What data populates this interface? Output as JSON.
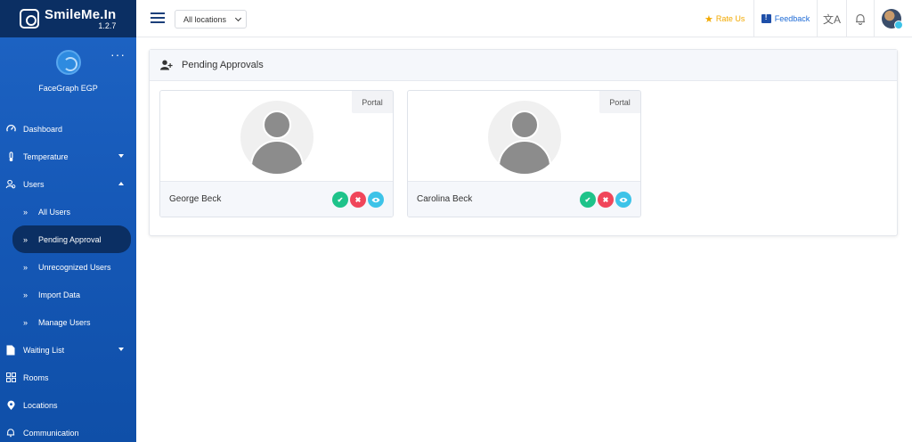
{
  "brand": {
    "name": "SmileMe.In",
    "version": "1.2.7"
  },
  "profile": {
    "name": "FaceGraph EGP",
    "more": "···"
  },
  "nav": {
    "dashboard": "Dashboard",
    "temperature": "Temperature",
    "users": "Users",
    "all_users": "All Users",
    "pending_approval": "Pending Approval",
    "unrecognized_users": "Unrecognized Users",
    "import_data": "Import Data",
    "manage_users": "Manage Users",
    "waiting_list": "Waiting List",
    "rooms": "Rooms",
    "locations": "Locations",
    "communication": "Communication"
  },
  "topbar": {
    "location_select": "All locations",
    "rate_us": "Rate Us",
    "feedback": "Feedback",
    "translate_glyph": "文A"
  },
  "panel": {
    "title": "Pending Approvals"
  },
  "cards": [
    {
      "name": "George Beck",
      "badge": "Portal"
    },
    {
      "name": "Carolina Beck",
      "badge": "Portal"
    }
  ],
  "action_glyphs": {
    "approve": "✔",
    "reject": "✖",
    "view": "👁"
  },
  "colors": {
    "sidebar": "#1659b8",
    "brand_bar": "#0b2f63",
    "approve": "#1ec38a",
    "reject": "#f0465a",
    "view": "#3dc3e8",
    "rate": "#f2a900",
    "feedback": "#1e6bd6"
  }
}
